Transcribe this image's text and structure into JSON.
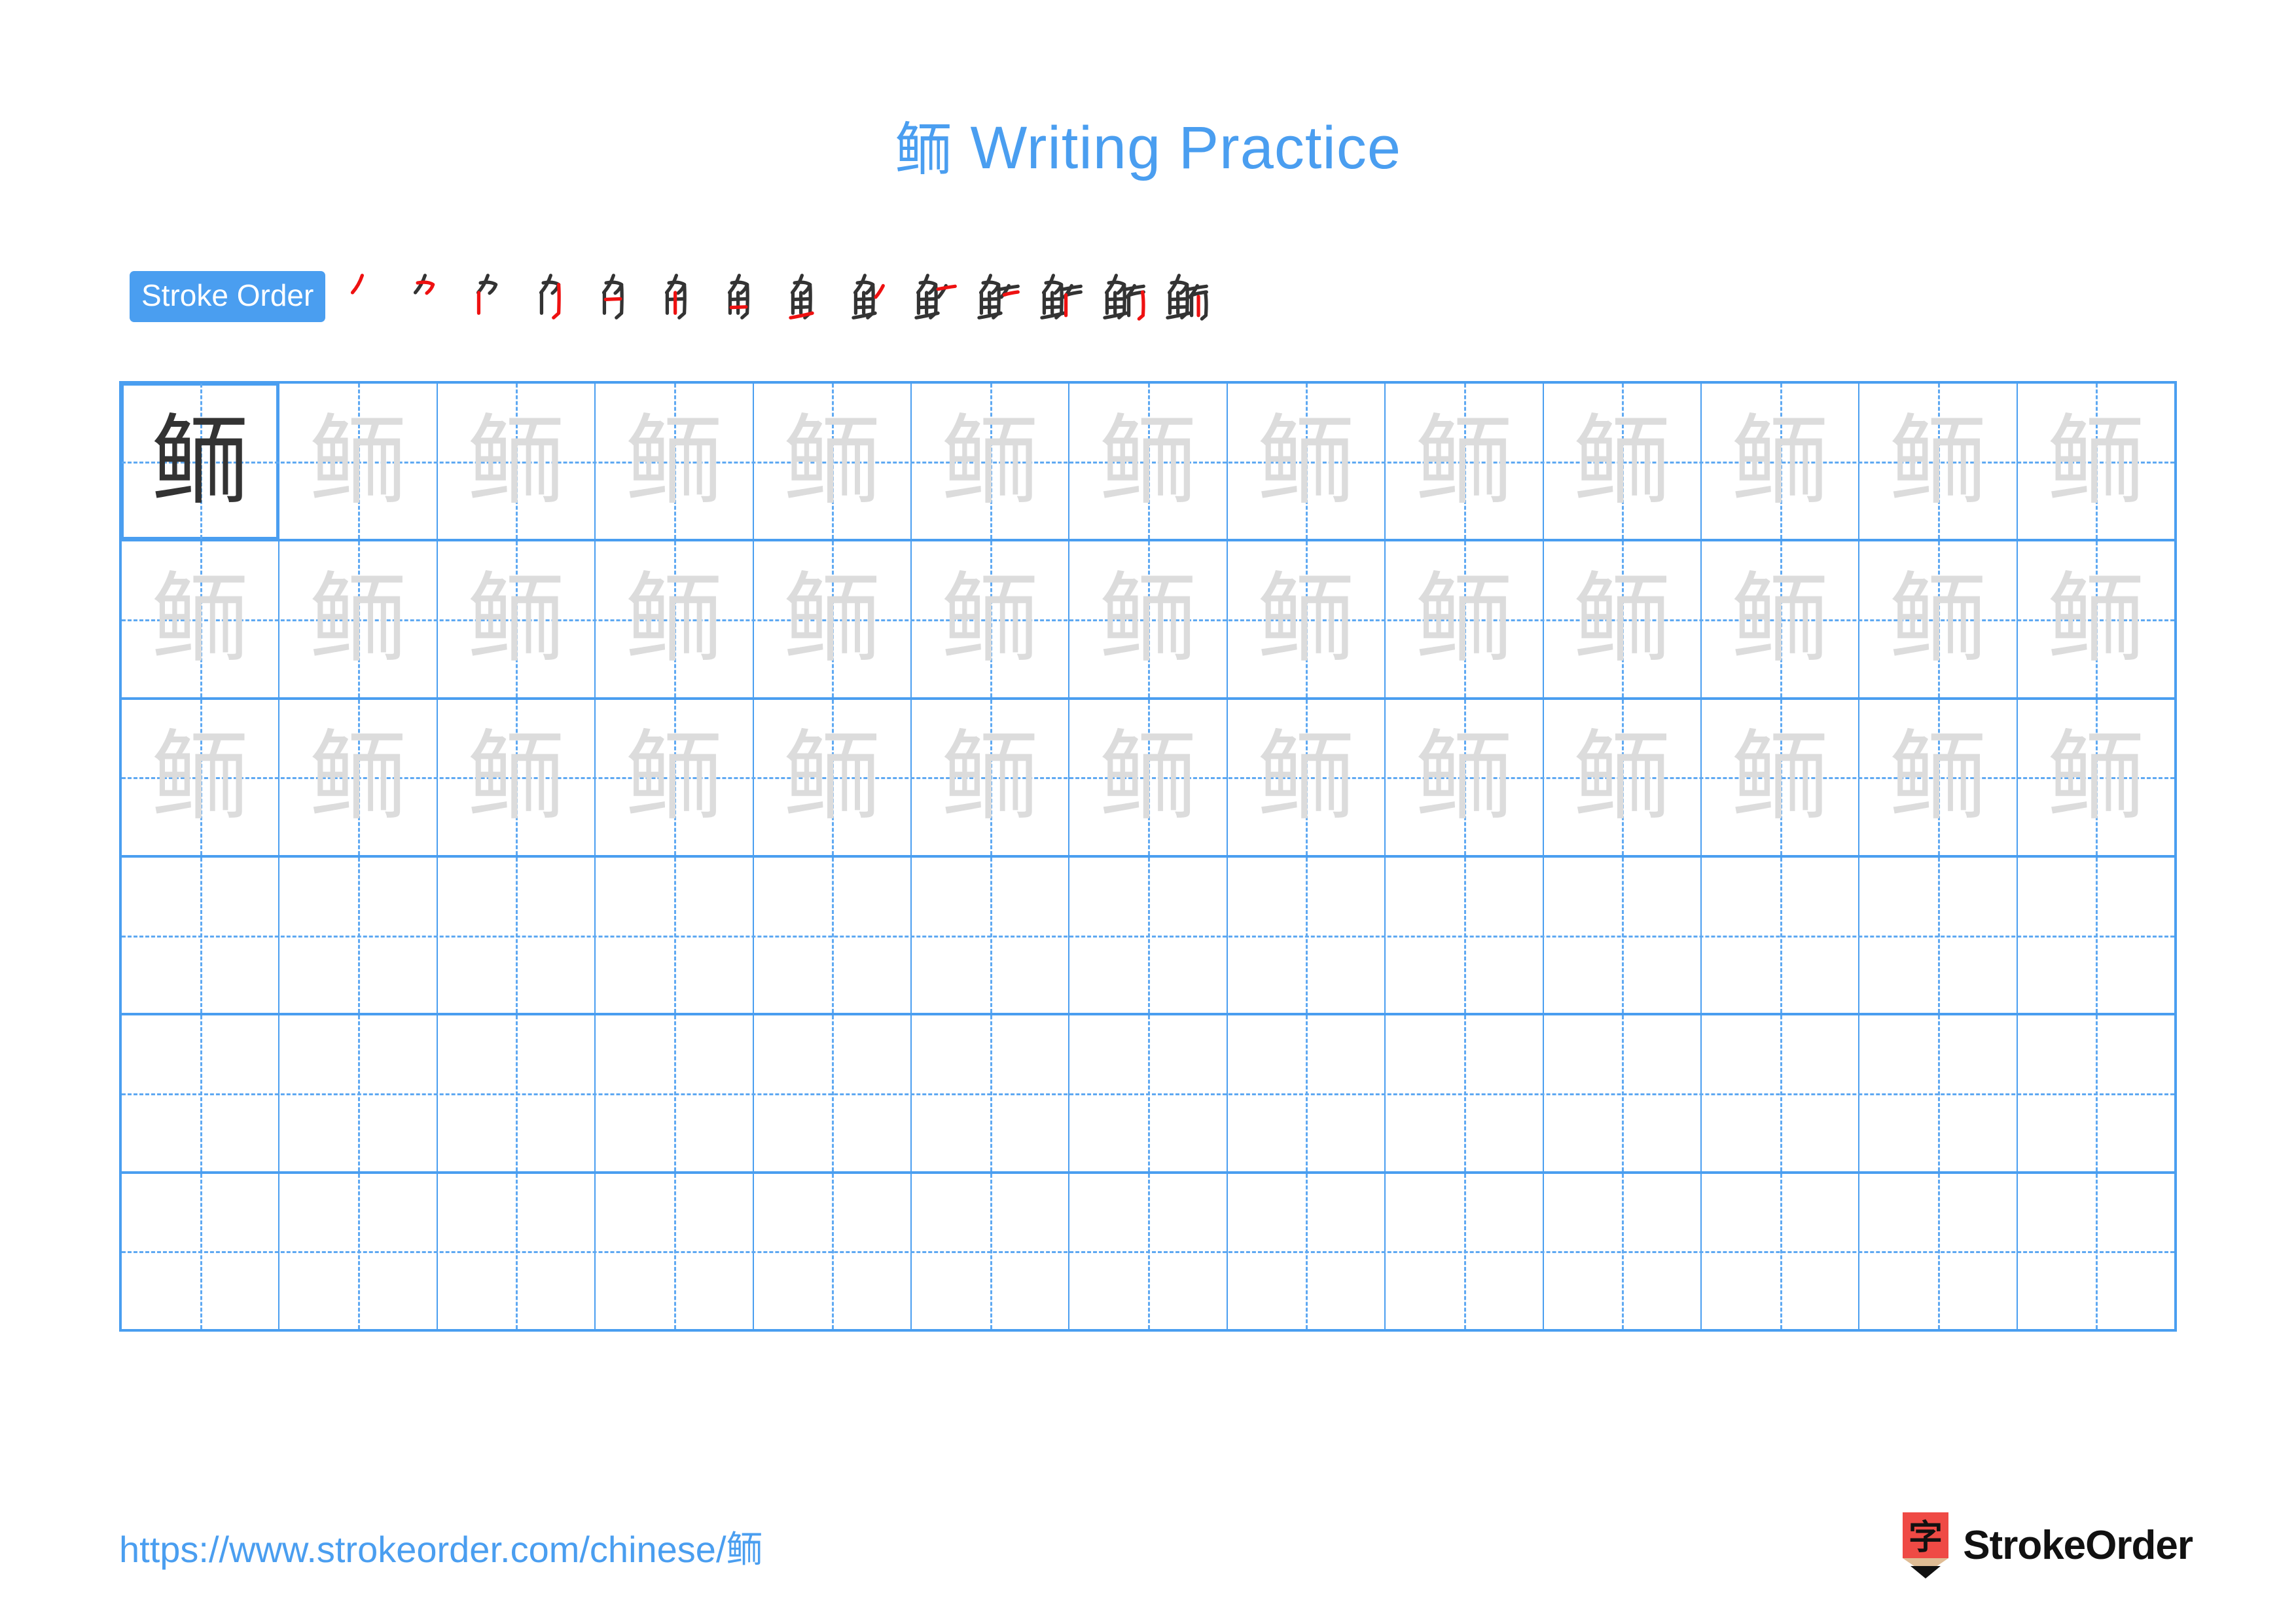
{
  "document": {
    "character": "鲕",
    "title_suffix": " Writing Practice",
    "background_color": "#ffffff"
  },
  "theme": {
    "accent_blue": "#4a9ef0",
    "grid_line": "#4a9ef0",
    "guide_line": "#5fa9f2",
    "model_ink": "#333333",
    "trace_ink": "#dcdcdc",
    "stroke_new": "#ee1111",
    "stroke_old": "#333333",
    "logo_red": "#ef4a45",
    "logo_wood": "#dfbc94"
  },
  "header": {
    "title_character": "鲕",
    "title_text": "Writing Practice"
  },
  "stroke_order": {
    "label": "Stroke Order",
    "stroke_count": 14,
    "steps": [
      {
        "index": 1,
        "glyph": "丿",
        "new_stroke": "丿"
      },
      {
        "index": 2,
        "glyph": "⺈",
        "new_stroke": "㇇"
      },
      {
        "index": 3,
        "glyph": "⺈丨",
        "new_stroke": "丨"
      },
      {
        "index": 4,
        "glyph": "刍",
        "new_stroke": "㇉"
      },
      {
        "index": 5,
        "glyph": "𠂎",
        "new_stroke": "一"
      },
      {
        "index": 6,
        "glyph": "角",
        "new_stroke": "丨"
      },
      {
        "index": 7,
        "glyph": "鱼",
        "new_stroke": "一"
      },
      {
        "index": 8,
        "glyph": "鱼",
        "new_stroke": "一"
      },
      {
        "index": 9,
        "glyph": "鱼丿",
        "new_stroke": "丿"
      },
      {
        "index": 10,
        "glyph": "鱼一",
        "new_stroke": "一"
      },
      {
        "index": 11,
        "glyph": "鱼丿",
        "new_stroke": "丿"
      },
      {
        "index": 12,
        "glyph": "鲕",
        "new_stroke": "丨"
      },
      {
        "index": 13,
        "glyph": "鲕",
        "new_stroke": "㇆"
      },
      {
        "index": 14,
        "glyph": "鲕",
        "new_stroke": "丨"
      }
    ]
  },
  "practice_grid": {
    "columns": 13,
    "rows": 6,
    "rows_data": [
      {
        "row": 1,
        "cells": [
          "鲕",
          "鲕",
          "鲕",
          "鲕",
          "鲕",
          "鲕",
          "鲕",
          "鲕",
          "鲕",
          "鲕",
          "鲕",
          "鲕",
          "鲕"
        ],
        "styles": [
          "model",
          "trace",
          "trace",
          "trace",
          "trace",
          "trace",
          "trace",
          "trace",
          "trace",
          "trace",
          "trace",
          "trace",
          "trace"
        ]
      },
      {
        "row": 2,
        "cells": [
          "鲕",
          "鲕",
          "鲕",
          "鲕",
          "鲕",
          "鲕",
          "鲕",
          "鲕",
          "鲕",
          "鲕",
          "鲕",
          "鲕",
          "鲕"
        ],
        "styles": [
          "trace",
          "trace",
          "trace",
          "trace",
          "trace",
          "trace",
          "trace",
          "trace",
          "trace",
          "trace",
          "trace",
          "trace",
          "trace"
        ]
      },
      {
        "row": 3,
        "cells": [
          "鲕",
          "鲕",
          "鲕",
          "鲕",
          "鲕",
          "鲕",
          "鲕",
          "鲕",
          "鲕",
          "鲕",
          "鲕",
          "鲕",
          "鲕"
        ],
        "styles": [
          "trace",
          "trace",
          "trace",
          "trace",
          "trace",
          "trace",
          "trace",
          "trace",
          "trace",
          "trace",
          "trace",
          "trace",
          "trace"
        ]
      },
      {
        "row": 4,
        "cells": [
          "",
          "",
          "",
          "",
          "",
          "",
          "",
          "",
          "",
          "",
          "",
          "",
          ""
        ],
        "styles": [
          "blank",
          "blank",
          "blank",
          "blank",
          "blank",
          "blank",
          "blank",
          "blank",
          "blank",
          "blank",
          "blank",
          "blank",
          "blank"
        ]
      },
      {
        "row": 5,
        "cells": [
          "",
          "",
          "",
          "",
          "",
          "",
          "",
          "",
          "",
          "",
          "",
          "",
          ""
        ],
        "styles": [
          "blank",
          "blank",
          "blank",
          "blank",
          "blank",
          "blank",
          "blank",
          "blank",
          "blank",
          "blank",
          "blank",
          "blank",
          "blank"
        ]
      },
      {
        "row": 6,
        "cells": [
          "",
          "",
          "",
          "",
          "",
          "",
          "",
          "",
          "",
          "",
          "",
          "",
          ""
        ],
        "styles": [
          "blank",
          "blank",
          "blank",
          "blank",
          "blank",
          "blank",
          "blank",
          "blank",
          "blank",
          "blank",
          "blank",
          "blank",
          "blank"
        ]
      }
    ]
  },
  "footer": {
    "url_text": "https://www.strokeorder.com/chinese/鲕",
    "brand_name": "StrokeOrder",
    "brand_mark_character": "字"
  }
}
